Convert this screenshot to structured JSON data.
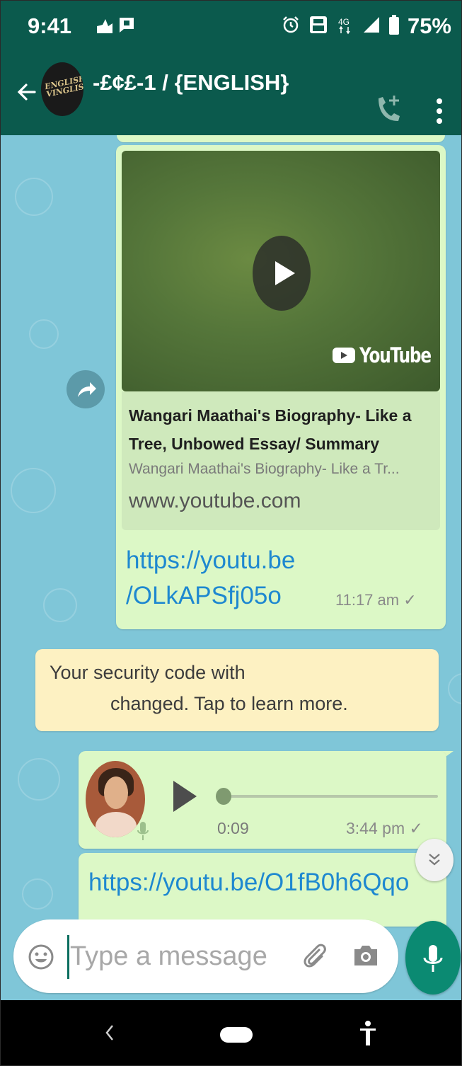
{
  "status_bar": {
    "time": "9:41",
    "battery": "75%",
    "icons": [
      "notification-icon",
      "message-icon",
      "alarm-icon",
      "volte-icon",
      "4g-icon",
      "signal-icon",
      "battery-icon"
    ]
  },
  "header": {
    "title": "-£¢£-1 / {ENGLISH}",
    "avatar_text": [
      "ENGLISH",
      "VINGLISH"
    ],
    "icons": [
      "back-arrow-icon",
      "add-call-icon",
      "more-vert-icon"
    ]
  },
  "messages": [
    {
      "type": "link_preview",
      "thumbnail_badge": "YouTube",
      "preview_title": "Wangari Maathai's Biography- Like a Tree, Unbowed Essay/ Summary",
      "preview_description": "Wangari Maathai's Biography- Like a Tr...",
      "preview_domain": "www.youtube.com",
      "url_line1": "https://youtu.be",
      "url_line2": "/OLkAPSfj05o",
      "time": "11:17 am",
      "status": "✓"
    },
    {
      "type": "system",
      "line1": "Your security code with",
      "line2": "changed. Tap to learn more."
    },
    {
      "type": "voice",
      "duration": "0:09",
      "time": "3:44 pm",
      "status": "✓",
      "progress": 0.0
    },
    {
      "type": "text",
      "text": "https://youtu.be/O1fB0h6Qqo"
    }
  ],
  "composer": {
    "placeholder": "Type a message"
  },
  "colors": {
    "header": "#0b5a4d",
    "chat_bg": "#7fc6d8",
    "outgoing_bubble": "#dcf8c6",
    "system_bubble": "#fdf1c2",
    "link": "#1e88d0",
    "fab": "#0b8a72"
  }
}
